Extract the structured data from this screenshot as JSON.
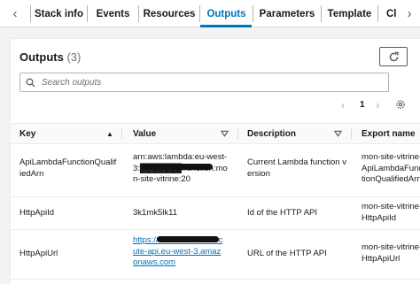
{
  "tabs": [
    {
      "label": "Stack info",
      "active": false
    },
    {
      "label": "Events",
      "active": false
    },
    {
      "label": "Resources",
      "active": false
    },
    {
      "label": "Outputs",
      "active": true
    },
    {
      "label": "Parameters",
      "active": false
    },
    {
      "label": "Template",
      "active": false
    },
    {
      "label": "Cl",
      "active": false
    }
  ],
  "outputs": {
    "title": "Outputs",
    "count": "(3)",
    "search_placeholder": "Search outputs",
    "page": "1",
    "columns": {
      "key": "Key",
      "value": "Value",
      "description": "Description",
      "export": "Export name"
    },
    "rows": [
      {
        "key": "ApiLambdaFunctionQualifiedArn",
        "value": "arn:aws:lambda:eu-west-3:███████:function:mon-site-vitrine:20",
        "description": "Current Lambda function version",
        "export": "mon-site-vitrine-ApiLambdaFunctionQualifiedArn"
      },
      {
        "key": "HttpApiId",
        "value": "3k1mk5lk11",
        "description": "Id of the HTTP API",
        "export": "mon-site-vitrine-HttpApiId"
      },
      {
        "key": "HttpApiUrl",
        "value": "https://3k1mk5lk11.execute-api.eu-west-3.amazonaws.com",
        "description": "URL of the HTTP API",
        "export": "mon-site-vitrine-HttpApiUrl"
      }
    ]
  },
  "colors": {
    "accent": "#0073bb",
    "text": "#16191f",
    "muted": "#687078"
  }
}
